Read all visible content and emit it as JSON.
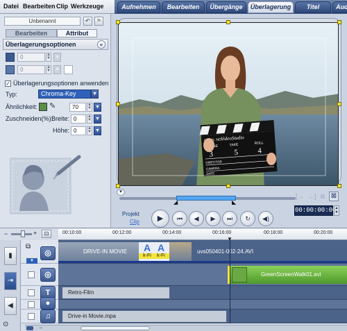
{
  "menu": {
    "items": [
      "Datei",
      "Bearbeiten",
      "Clip",
      "Werkzeuge"
    ]
  },
  "tabs": {
    "items": [
      "Aufnehmen",
      "Bearbeiten",
      "Übergänge",
      "Überlagerung",
      "Titel",
      "Audi"
    ],
    "active": "Überlagerung"
  },
  "left": {
    "clip_name": "Unbenannt",
    "subtabs": [
      "Bearbeiten",
      "Attribut"
    ],
    "active_subtab": "Attribut",
    "section_title": "Überlagerungsoptionen",
    "collapse_glyph": "«",
    "field1_value": "0",
    "field2_value": "0",
    "apply_label": "Überlagerungsoptionen anwenden",
    "apply_checked": true,
    "type_label": "Typ:",
    "type_value": "Chroma-Key",
    "similarity_label": "Ähnlichkeit:",
    "similarity_value": "70",
    "crop_label": "Zuschneiden(%):",
    "width_label": "Breite:",
    "width_value": "0",
    "height_label": "Höhe:",
    "height_value": "0",
    "key_color": "#5a8f48"
  },
  "preview": {
    "project_label": "Projekt",
    "clip_label": "Clip",
    "timecode": "00:00:00:00",
    "controls": [
      "play",
      "home",
      "prev-frame",
      "next-frame",
      "end",
      "repeat",
      "volume"
    ],
    "clapper_text": [
      "PROD. NO.",
      "VideoStudio",
      "SCENE",
      "TAKE",
      "ROLL",
      "3",
      "5",
      "4",
      "DIRECTOR",
      "CAMERA",
      "DATE"
    ]
  },
  "timeline": {
    "ruler_labels": [
      "00:10:00",
      "00:12:00",
      "00:14:00",
      "00:16:00",
      "00:18:00",
      "00:20:00"
    ],
    "tracks": {
      "video_clip1": "DRIVE-IN MOVIE",
      "video_clip2": "uvs050401-002-24.AVI",
      "transition_label": "k-Fi",
      "overlay_clip": "GreenScreenWalk01.avi",
      "title_clip": "Retro-Film",
      "music_clip": "Drive-in Movie.mpa"
    }
  },
  "colors": {
    "accent": "#2f61b8",
    "handle": "#f2e43a",
    "track": "#4b6289"
  }
}
